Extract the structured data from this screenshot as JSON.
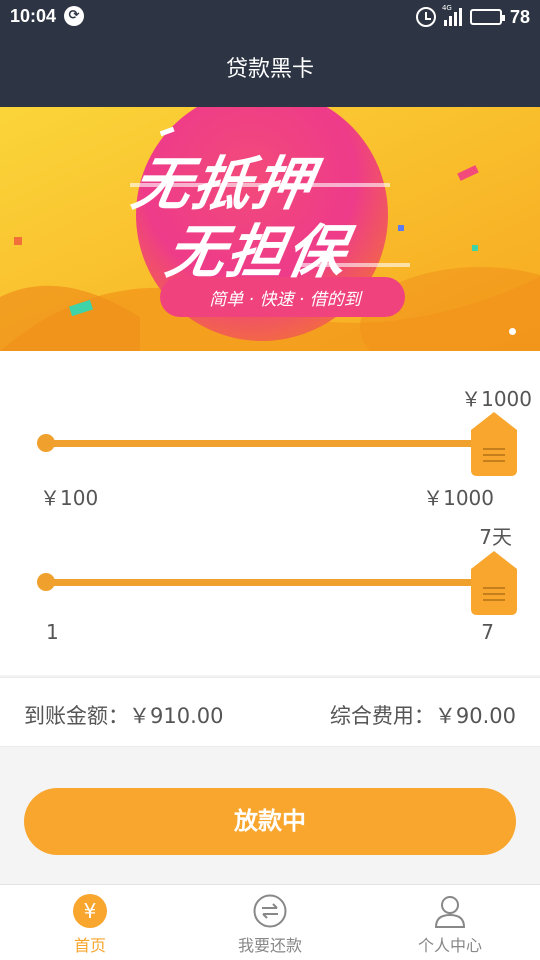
{
  "status_bar": {
    "time": "10:04",
    "sync_icon": "sync-icon",
    "network_label": "4G",
    "battery": "78",
    "battery_level": 0.78
  },
  "header": {
    "title": "贷款黑卡"
  },
  "banner": {
    "line1": "无抵押",
    "line2": "无担保",
    "tagline": "简单 · 快速 · 借的到"
  },
  "amount_slider": {
    "current_value": "￥1000",
    "min_label": "￥100",
    "max_label": "￥1000",
    "position": 1.0
  },
  "days_slider": {
    "current_value": "7天",
    "min_label": "1",
    "max_label": "7",
    "position": 1.0
  },
  "summary": {
    "received": "到账金额：￥910.00",
    "fees": "综合费用：￥90.00"
  },
  "action": {
    "label": "放款中"
  },
  "nav": {
    "items": [
      {
        "label": "首页",
        "icon": "yen-icon",
        "active": true
      },
      {
        "label": "我要还款",
        "icon": "exchange-icon",
        "active": false
      },
      {
        "label": "个人中心",
        "icon": "user-icon",
        "active": false
      }
    ]
  },
  "colors": {
    "accent": "#f8a62e",
    "header": "#2d3443"
  }
}
